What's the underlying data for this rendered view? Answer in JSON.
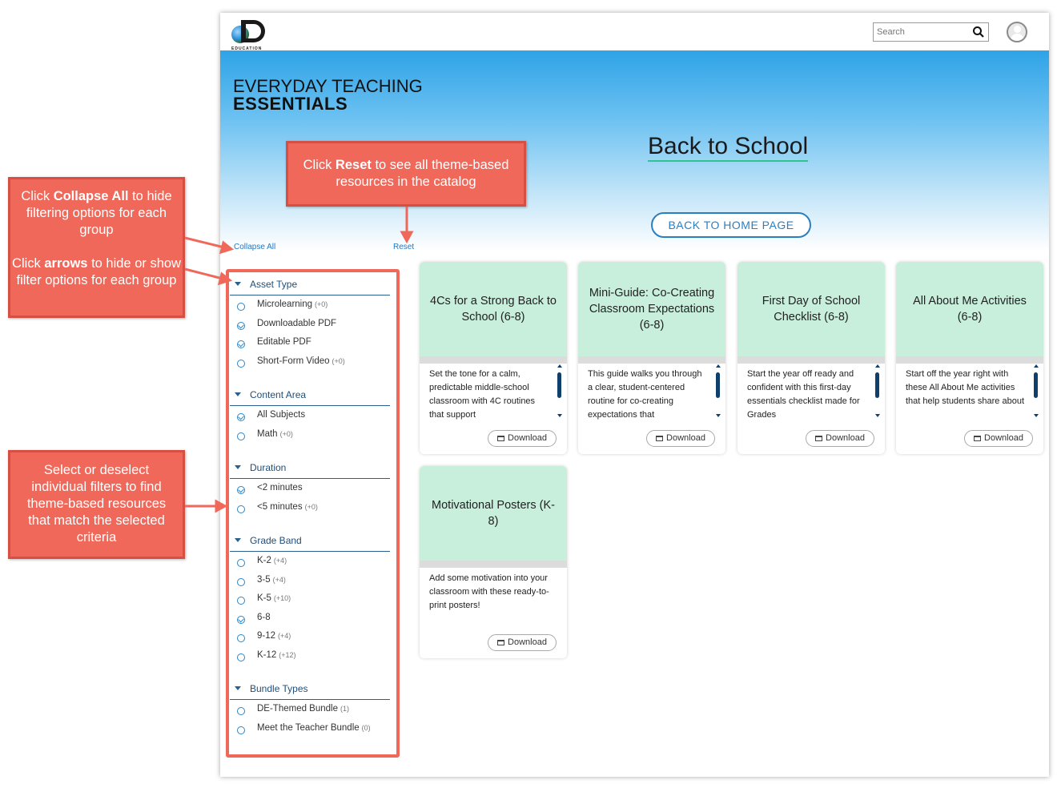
{
  "logo": {
    "text": "EDUCATION"
  },
  "search": {
    "placeholder": "Search"
  },
  "hero": {
    "brand_line1": "EVERYDAY TEACHING",
    "brand_line2": "ESSENTIALS",
    "title": "Back to School",
    "back_button": "BACK TO HOME PAGE"
  },
  "links": {
    "collapse_all": "Collapse All",
    "reset": "Reset"
  },
  "filters": [
    {
      "title": "Asset Type",
      "options": [
        {
          "label": "Microlearning",
          "count": "(+0)",
          "checked": false
        },
        {
          "label": "Downloadable PDF",
          "count": "",
          "checked": true
        },
        {
          "label": "Editable PDF",
          "count": "",
          "checked": true
        },
        {
          "label": "Short-Form Video",
          "count": "(+0)",
          "checked": false
        }
      ]
    },
    {
      "title": "Content Area",
      "options": [
        {
          "label": "All Subjects",
          "count": "",
          "checked": true
        },
        {
          "label": "Math",
          "count": "(+0)",
          "checked": false
        }
      ]
    },
    {
      "title": "Duration",
      "options": [
        {
          "label": "<2 minutes",
          "count": "",
          "checked": true
        },
        {
          "label": "<5 minutes",
          "count": "(+0)",
          "checked": false
        }
      ]
    },
    {
      "title": "Grade Band",
      "options": [
        {
          "label": "K-2",
          "count": "(+4)",
          "checked": false
        },
        {
          "label": "3-5",
          "count": "(+4)",
          "checked": false
        },
        {
          "label": "K-5",
          "count": "(+10)",
          "checked": false
        },
        {
          "label": "6-8",
          "count": "",
          "checked": true
        },
        {
          "label": "9-12",
          "count": "(+4)",
          "checked": false
        },
        {
          "label": "K-12",
          "count": "(+12)",
          "checked": false
        }
      ]
    },
    {
      "title": "Bundle Types",
      "options": [
        {
          "label": "DE-Themed Bundle",
          "count": "(1)",
          "checked": false
        },
        {
          "label": "Meet the Teacher Bundle",
          "count": "(0)",
          "checked": false
        }
      ]
    }
  ],
  "cards": [
    {
      "title": "4Cs for a Strong Back to School (6-8)",
      "desc": "Set the tone for a calm, predictable middle-school classroom with 4C routines that support",
      "download": "Download",
      "scroll": true
    },
    {
      "title": "Mini-Guide: Co-Creating Classroom Expectations (6-8)",
      "desc": "This guide walks you through a clear, student-centered routine for co-creating expectations that",
      "download": "Download",
      "scroll": true
    },
    {
      "title": "First Day of School Checklist (6-8)",
      "desc": "Start the year off ready and confident with this first-day essentials checklist made for Grades",
      "download": "Download",
      "scroll": true
    },
    {
      "title": "All About Me Activities (6-8)",
      "desc": "Start off the year right with these All About Me activities that help students share about",
      "download": "Download",
      "scroll": true
    },
    {
      "title": "Motivational Posters (K-8)",
      "desc": "Add some motivation into your classroom with these ready-to-print posters!",
      "download": "Download",
      "scroll": false
    }
  ],
  "callouts": {
    "collapse_prefix": "Click ",
    "collapse_bold": "Collapse All",
    "collapse_suffix": " to hide filtering options for each group",
    "arrows_prefix": "Click ",
    "arrows_bold": "arrows",
    "arrows_suffix": " to hide or show filter options for each group",
    "reset_prefix": "Click ",
    "reset_bold": "Reset",
    "reset_suffix": " to see all theme-based resources in the catalog",
    "select_text": "Select or deselect individual filters to find theme-based resources that match the selected criteria"
  },
  "colors": {
    "callout": "#f0685a",
    "accent_blue": "#2a7fc1",
    "card_top": "#c8eedc"
  }
}
